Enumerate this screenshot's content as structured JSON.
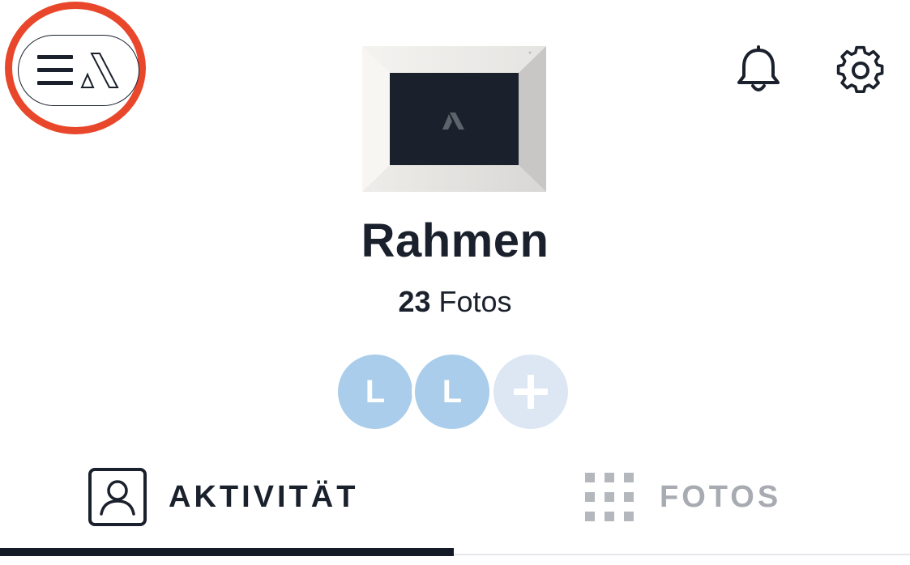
{
  "header": {
    "menu_icon": "hamburger-icon",
    "logo": "aura-logo",
    "notifications_icon": "bell-icon",
    "settings_icon": "gear-icon"
  },
  "frame": {
    "name": "Rahmen",
    "photo_count": "23",
    "photo_unit": "Fotos"
  },
  "members": [
    {
      "initial": "L"
    },
    {
      "initial": "L"
    }
  ],
  "add_member_icon": "plus-icon",
  "tabs": [
    {
      "label": "AKTIVITÄT",
      "icon": "person-icon",
      "active": true
    },
    {
      "label": "FOTOS",
      "icon": "grid-icon",
      "active": false
    }
  ],
  "colors": {
    "highlight": "#e8472b",
    "text": "#1a202c",
    "avatar": "#a9cdea",
    "avatar_add": "#dde7f3",
    "tab_inactive": "#a8acb2",
    "tab_indicator": "#131b27"
  }
}
